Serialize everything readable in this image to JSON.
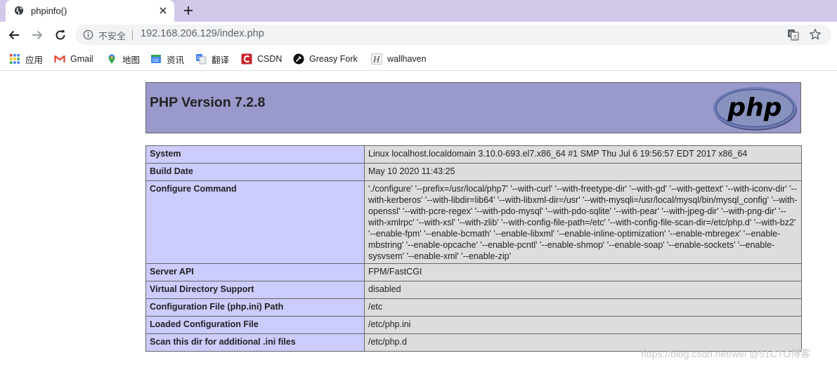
{
  "tab": {
    "title": "phpinfo()"
  },
  "omnibox": {
    "security_label": "不安全",
    "url": "192.168.206.129/index.php"
  },
  "bookmarks": [
    {
      "label": "应用",
      "icon": "apps-grid-icon"
    },
    {
      "label": "Gmail",
      "icon": "gmail-icon"
    },
    {
      "label": "地图",
      "icon": "maps-icon"
    },
    {
      "label": "资讯",
      "icon": "news-icon"
    },
    {
      "label": "翻译",
      "icon": "translate-icon"
    },
    {
      "label": "CSDN",
      "icon": "csdn-icon"
    },
    {
      "label": "Greasy Fork",
      "icon": "greasyfork-icon"
    },
    {
      "label": "wallhaven",
      "icon": "wallhaven-icon"
    }
  ],
  "phpinfo": {
    "title": "PHP Version 7.2.8",
    "logo_text": "php",
    "rows": [
      {
        "key": "System",
        "value": "Linux localhost.localdomain 3.10.0-693.el7.x86_64 #1 SMP Thu Jul 6 19:56:57 EDT 2017 x86_64"
      },
      {
        "key": "Build Date",
        "value": "May 10 2020 11:43:25"
      },
      {
        "key": "Configure Command",
        "value": "'./configure' '--prefix=/usr/local/php7' '--with-curl' '--with-freetype-dir' '--with-gd' '--with-gettext' '--with-iconv-dir' '--with-kerberos' '--with-libdir=lib64' '--with-libxml-dir=/usr' '--with-mysqli=/usr/local/mysql/bin/mysql_config' '--with-openssl' '--with-pcre-regex' '--with-pdo-mysql' '--with-pdo-sqlite' '--with-pear' '--with-jpeg-dir' '--with-png-dir' '--with-xmlrpc' '--with-xsl' '--with-zlib' '--with-config-file-path=/etc' '--with-config-file-scan-dir=/etc/php.d' '--with-bz2' '--enable-fpm' '--enable-bcmath' '--enable-libxml' '--enable-inline-optimization' '--enable-mbregex' '--enable-mbstring' '--enable-opcache' '--enable-pcntl' '--enable-shmop' '--enable-soap' '--enable-sockets' '--enable-sysvsem' '--enable-xml' '--enable-zip'"
      },
      {
        "key": "Server API",
        "value": "FPM/FastCGI"
      },
      {
        "key": "Virtual Directory Support",
        "value": "disabled"
      },
      {
        "key": "Configuration File (php.ini) Path",
        "value": "/etc"
      },
      {
        "key": "Loaded Configuration File",
        "value": "/etc/php.ini"
      },
      {
        "key": "Scan this dir for additional .ini files",
        "value": "/etc/php.d"
      }
    ]
  },
  "watermark": "https://blog.csdn.net/wei @51CTO博客",
  "colors": {
    "tabstrip": "#d4c8ea",
    "php_header": "#9999cc",
    "key_cell": "#ccccff",
    "value_cell": "#dddddd"
  }
}
